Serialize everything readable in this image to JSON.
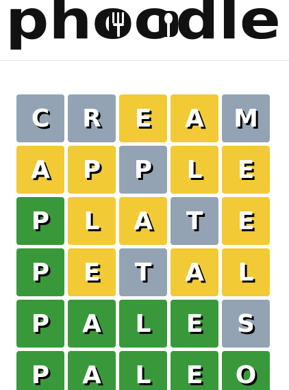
{
  "header": {
    "logo_text": "phoodle"
  },
  "colors": {
    "gray": "#93a3b4",
    "yellow": "#f1ca35",
    "green": "#39993a"
  },
  "board": {
    "rows": [
      [
        {
          "letter": "C",
          "state": "gray"
        },
        {
          "letter": "R",
          "state": "gray"
        },
        {
          "letter": "E",
          "state": "yellow"
        },
        {
          "letter": "A",
          "state": "yellow"
        },
        {
          "letter": "M",
          "state": "gray"
        }
      ],
      [
        {
          "letter": "A",
          "state": "yellow"
        },
        {
          "letter": "P",
          "state": "yellow"
        },
        {
          "letter": "P",
          "state": "gray"
        },
        {
          "letter": "L",
          "state": "yellow"
        },
        {
          "letter": "E",
          "state": "yellow"
        }
      ],
      [
        {
          "letter": "P",
          "state": "green"
        },
        {
          "letter": "L",
          "state": "yellow"
        },
        {
          "letter": "A",
          "state": "yellow"
        },
        {
          "letter": "T",
          "state": "gray"
        },
        {
          "letter": "E",
          "state": "yellow"
        }
      ],
      [
        {
          "letter": "P",
          "state": "green"
        },
        {
          "letter": "E",
          "state": "yellow"
        },
        {
          "letter": "T",
          "state": "gray"
        },
        {
          "letter": "A",
          "state": "yellow"
        },
        {
          "letter": "L",
          "state": "yellow"
        }
      ],
      [
        {
          "letter": "P",
          "state": "green"
        },
        {
          "letter": "A",
          "state": "green"
        },
        {
          "letter": "L",
          "state": "green"
        },
        {
          "letter": "E",
          "state": "green"
        },
        {
          "letter": "S",
          "state": "gray"
        }
      ],
      [
        {
          "letter": "P",
          "state": "green"
        },
        {
          "letter": "A",
          "state": "green"
        },
        {
          "letter": "L",
          "state": "green"
        },
        {
          "letter": "E",
          "state": "green"
        },
        {
          "letter": "O",
          "state": "green"
        }
      ]
    ]
  }
}
